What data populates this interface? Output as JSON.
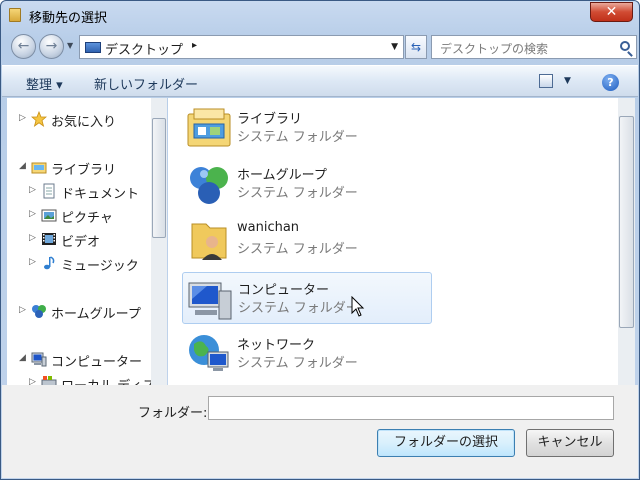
{
  "window": {
    "title": "移動先の選択",
    "close_label": "✕"
  },
  "nav": {
    "address_label": "デスクトップ",
    "address_arrow": "▸",
    "address_dropdown": "▼",
    "refresh_glyph": "⇆",
    "search_placeholder": "デスクトップの検索"
  },
  "toolbar": {
    "organize_label": "整理 ▾",
    "new_folder_label": "新しいフォルダー",
    "help_label": "?"
  },
  "tree": {
    "items": [
      {
        "label": "お気に入り",
        "arrow": "▷",
        "icon": "star-icon"
      },
      {
        "label": "ライブラリ",
        "arrow": "◢",
        "icon": "library-icon"
      },
      {
        "label": "ドキュメント",
        "arrow": "▷",
        "icon": "document-icon"
      },
      {
        "label": "ピクチャ",
        "arrow": "▷",
        "icon": "picture-icon"
      },
      {
        "label": "ビデオ",
        "arrow": "▷",
        "icon": "video-icon"
      },
      {
        "label": "ミュージック",
        "arrow": "▷",
        "icon": "music-icon"
      },
      {
        "label": "ホームグループ",
        "arrow": "▷",
        "icon": "homegroup-icon"
      },
      {
        "label": "コンピューター",
        "arrow": "◢",
        "icon": "computer-icon"
      },
      {
        "label": "ローカル ディスク",
        "arrow": "▷",
        "icon": "disk-icon"
      }
    ]
  },
  "content": {
    "items": [
      {
        "name": "ライブラリ",
        "desc": "システム フォルダー",
        "icon": "library-icon"
      },
      {
        "name": "ホームグループ",
        "desc": "システム フォルダー",
        "icon": "homegroup-icon"
      },
      {
        "name": "wanichan",
        "desc": "システム フォルダー",
        "icon": "user-folder-icon"
      },
      {
        "name": "コンピューター",
        "desc": "システム フォルダー",
        "icon": "computer-icon",
        "selected": true
      },
      {
        "name": "ネットワーク",
        "desc": "システム フォルダー",
        "icon": "network-icon"
      }
    ]
  },
  "footer": {
    "folder_label": "フォルダー:",
    "folder_value": "",
    "select_button": "フォルダーの選択",
    "cancel_button": "キャンセル"
  }
}
